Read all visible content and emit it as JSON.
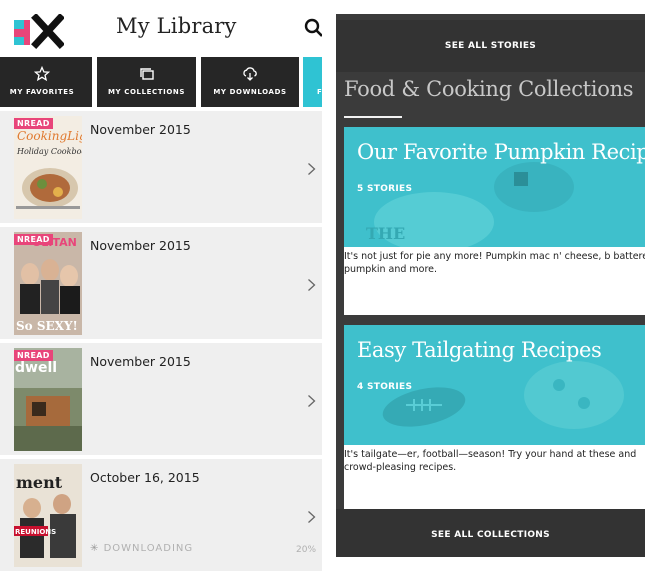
{
  "library": {
    "title": "My Library",
    "tabs": [
      {
        "label": "MY FAVORITES",
        "icon": "star-icon"
      },
      {
        "label": "MY COLLECTIONS",
        "icon": "collections-icon"
      },
      {
        "label": "MY DOWNLOADS",
        "icon": "cloud-download-icon"
      },
      {
        "label": "F",
        "icon": ""
      }
    ],
    "unread_label": "NREAD",
    "items": [
      {
        "date": "November 2015",
        "unread": true
      },
      {
        "date": "November 2015",
        "unread": true
      },
      {
        "date": "November 2015",
        "unread": true
      },
      {
        "date": "October 16, 2015",
        "unread": false
      }
    ],
    "download": {
      "status": "DOWNLOADING",
      "percent": "20%"
    }
  },
  "stories": {
    "see_all_stories": "SEE ALL STORIES",
    "section_title": "Food & Cooking Collections",
    "collections": [
      {
        "title": "Our Favorite Pumpkin Recipe",
        "count": "5 STORIES",
        "description": "It's not just for pie any more! Pumpkin mac n' cheese, b battered pumpkin and more."
      },
      {
        "title": "Easy Tailgating Recipes",
        "count": "4 STORIES",
        "description": "It's tailgate—er, football—season! Try your hand at these and crowd-pleasing recipes."
      }
    ],
    "see_all_collections": "SEE ALL COLLECTIONS"
  },
  "colors": {
    "accent_teal": "#2fc3d3",
    "unread_pink": "#e8457a",
    "tab_dark": "#262626",
    "panel_dark": "#3b3b3b"
  }
}
